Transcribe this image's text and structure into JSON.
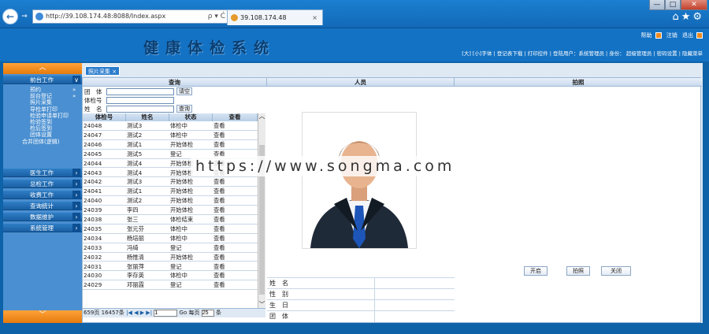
{
  "browser": {
    "address": "http://39.108.174.48:8088/Index.aspx",
    "tab_title": "39.108.174.48",
    "tab_close": "×",
    "search_ctrl": "ρ ▾ Ċ",
    "win_min": "—",
    "win_max": "□",
    "win_close": "✕",
    "back": "←",
    "forward": "→",
    "toolbar_icons": "⌂★⚙"
  },
  "app": {
    "title": "健康体检系统",
    "help": "帮助",
    "logout": "注销",
    "exit": "退出",
    "info_line": "[大] [小]字体 | 登记表下载 | 打印控件 | 登陆用户：系统管理员 | 身份： 超级管理员 | 密码设置 | 隐藏菜单"
  },
  "sidebar": {
    "up": "︿",
    "down": "﹀",
    "front_section": "前台工作",
    "front_items": [
      "预约",
      "前台登记",
      "照片采集",
      "导检单打印",
      "检验申请单打印",
      "检验签到",
      "检后签到",
      "团体设置",
      "合并团体(逻辑)"
    ],
    "sections": [
      "医生工作",
      "总检工作",
      "收费工作",
      "查询统计",
      "数据维护",
      "系统管理"
    ],
    "chevron_down": "∨",
    "chevron_right": "›"
  },
  "main": {
    "page_tab": "照片采集",
    "page_tab_close": "×",
    "col_query": "查询",
    "col_person": "人员",
    "col_shoot": "拍照",
    "q_group": "团　体",
    "q_group_btn": "请空",
    "q_exam": "体检号",
    "q_name": "姓　名",
    "q_search_btn": "查询",
    "table_headers": [
      "体检号",
      "姓名",
      "状态",
      "查看"
    ],
    "rows": [
      [
        "24048",
        "测试3",
        "体检中",
        "查看"
      ],
      [
        "24047",
        "测试2",
        "体检中",
        "查看"
      ],
      [
        "24046",
        "测试1",
        "开始体检",
        "查看"
      ],
      [
        "24045",
        "测试5",
        "登记",
        "查看"
      ],
      [
        "24044",
        "测试4",
        "开始体检",
        "查看"
      ],
      [
        "24043",
        "测试4",
        "开始体检",
        "查看"
      ],
      [
        "24042",
        "测试3",
        "开始体检",
        "查看"
      ],
      [
        "24041",
        "测试1",
        "开始体检",
        "查看"
      ],
      [
        "24040",
        "测试2",
        "开始体检",
        "查看"
      ],
      [
        "24039",
        "李四",
        "开始体检",
        "查看"
      ],
      [
        "24038",
        "张三",
        "体检结束",
        "查看"
      ],
      [
        "24035",
        "张元芬",
        "体检中",
        "查看"
      ],
      [
        "24034",
        "杨培丽",
        "体检中",
        "查看"
      ],
      [
        "24033",
        "冯绮",
        "登记",
        "查看"
      ],
      [
        "24032",
        "杨惟清",
        "开始体检",
        "查看"
      ],
      [
        "24031",
        "张丽萍",
        "登记",
        "查看"
      ],
      [
        "24030",
        "李存英",
        "体检中",
        "查看"
      ],
      [
        "24029",
        "邓丽霞",
        "登记",
        "查看"
      ]
    ],
    "pager_pages": "659页",
    "pager_total": "16457条",
    "pager_nav": "|◀ ◀ ▶ ▶|",
    "pager_current": "1",
    "pager_go": "Go",
    "pager_per_label": "每页",
    "pager_per_value": "25",
    "pager_per_unit": "条",
    "info_labels": [
      "姓　名",
      "性　别",
      "生　日",
      "团　体"
    ],
    "btn_open": "开启",
    "btn_shoot": "拍照",
    "btn_close": "关闭",
    "watermark": "https://www.songma.com"
  }
}
